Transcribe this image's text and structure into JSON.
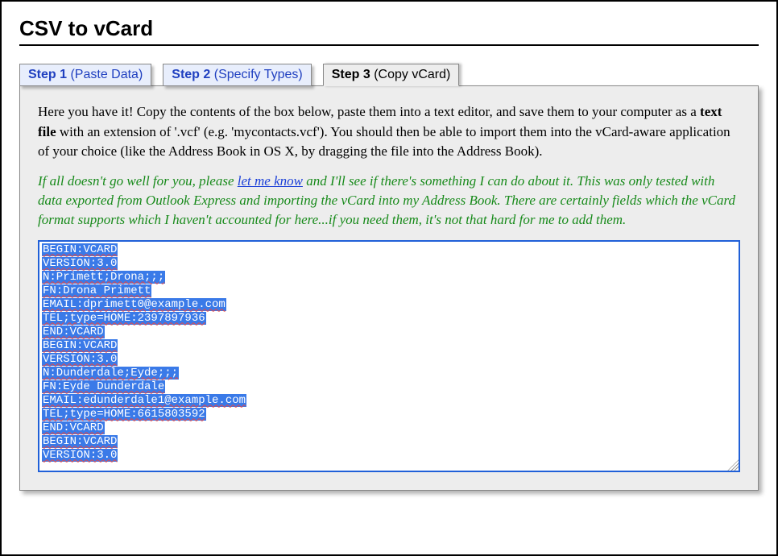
{
  "page_title": "CSV to vCard",
  "tabs": [
    {
      "step": "Step 1",
      "label": "(Paste Data)",
      "active": false
    },
    {
      "step": "Step 2",
      "label": "(Specify Types)",
      "active": false
    },
    {
      "step": "Step 3",
      "label": "(Copy vCard)",
      "active": true
    }
  ],
  "instructions": {
    "pre": "Here you have it! Copy the contents of the box below, paste them into a text editor, and save them to your computer as a ",
    "bold": "text file",
    "post": " with an extension of '.vcf' (e.g. 'mycontacts.vcf'). You should then be able to import them into the vCard-aware application of your choice (like the Address Book in OS X, by dragging the file into the Address Book)."
  },
  "note": {
    "pre": "If all doesn't go well for you, please ",
    "link": "let me know",
    "post": " and I'll see if there's something I can do about it. This was only tested with data exported from Outlook Express and importing the vCard into my Address Book. There are certainly fields which the vCard format supports which I haven't accounted for here...if you need them, it's not that hard for me to add them."
  },
  "output_lines": [
    "BEGIN:VCARD",
    "VERSION:3.0",
    "N:Primett;Drona;;;",
    "FN:Drona Primett",
    "EMAIL:dprimett0@example.com",
    "TEL;type=HOME:2397897936",
    "END:VCARD",
    "BEGIN:VCARD",
    "VERSION:3.0",
    "N:Dunderdale;Eyde;;;",
    "FN:Eyde Dunderdale",
    "EMAIL:edunderdale1@example.com",
    "TEL;type=HOME:6615803592",
    "END:VCARD",
    "BEGIN:VCARD",
    "VERSION:3.0"
  ]
}
